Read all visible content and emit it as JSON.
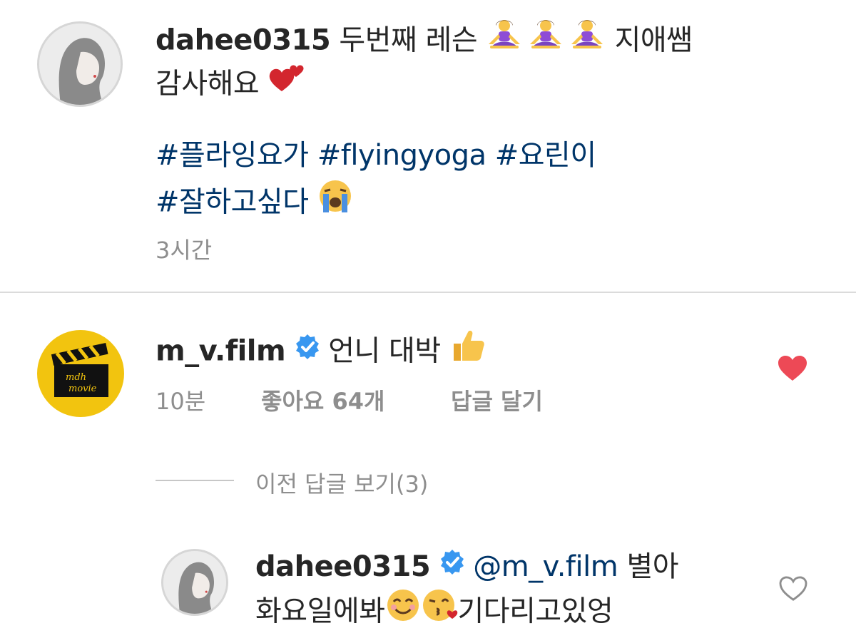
{
  "caption": {
    "username": "dahee0315",
    "text_line1": "두번째 레슨",
    "text_line1_tail": "지애쌤",
    "text_line2": "감사해요",
    "hashtags_line1": "#플라잉요가 #flyingyoga #요린이",
    "hashtags_line2": "#잘하고싶다",
    "time": "3시간"
  },
  "comment": {
    "username": "m_v.film",
    "text": "언니 대박",
    "time": "10분",
    "likes": "좋아요 64개",
    "reply": "답글 달기",
    "liked": true
  },
  "replies_toggle": "이전 답글 보기(3)",
  "reply_comment": {
    "username": "dahee0315",
    "mention": "@m_v.film",
    "text_line1": "별아",
    "text_line2_a": "화요일에봐",
    "text_line2_b": "기다리고있엉",
    "liked": false
  },
  "colors": {
    "link": "#003569",
    "meta": "#8e8e8e",
    "verified": "#3897f0",
    "heart": "#ed4956"
  },
  "icons": [
    "avatar",
    "yoga-emoji",
    "two-hearts-emoji",
    "crying-emoji",
    "verified-badge-icon",
    "thumbs-up-emoji",
    "heart-icon",
    "smile-emoji",
    "kiss-emoji",
    "heart-outline-icon"
  ]
}
